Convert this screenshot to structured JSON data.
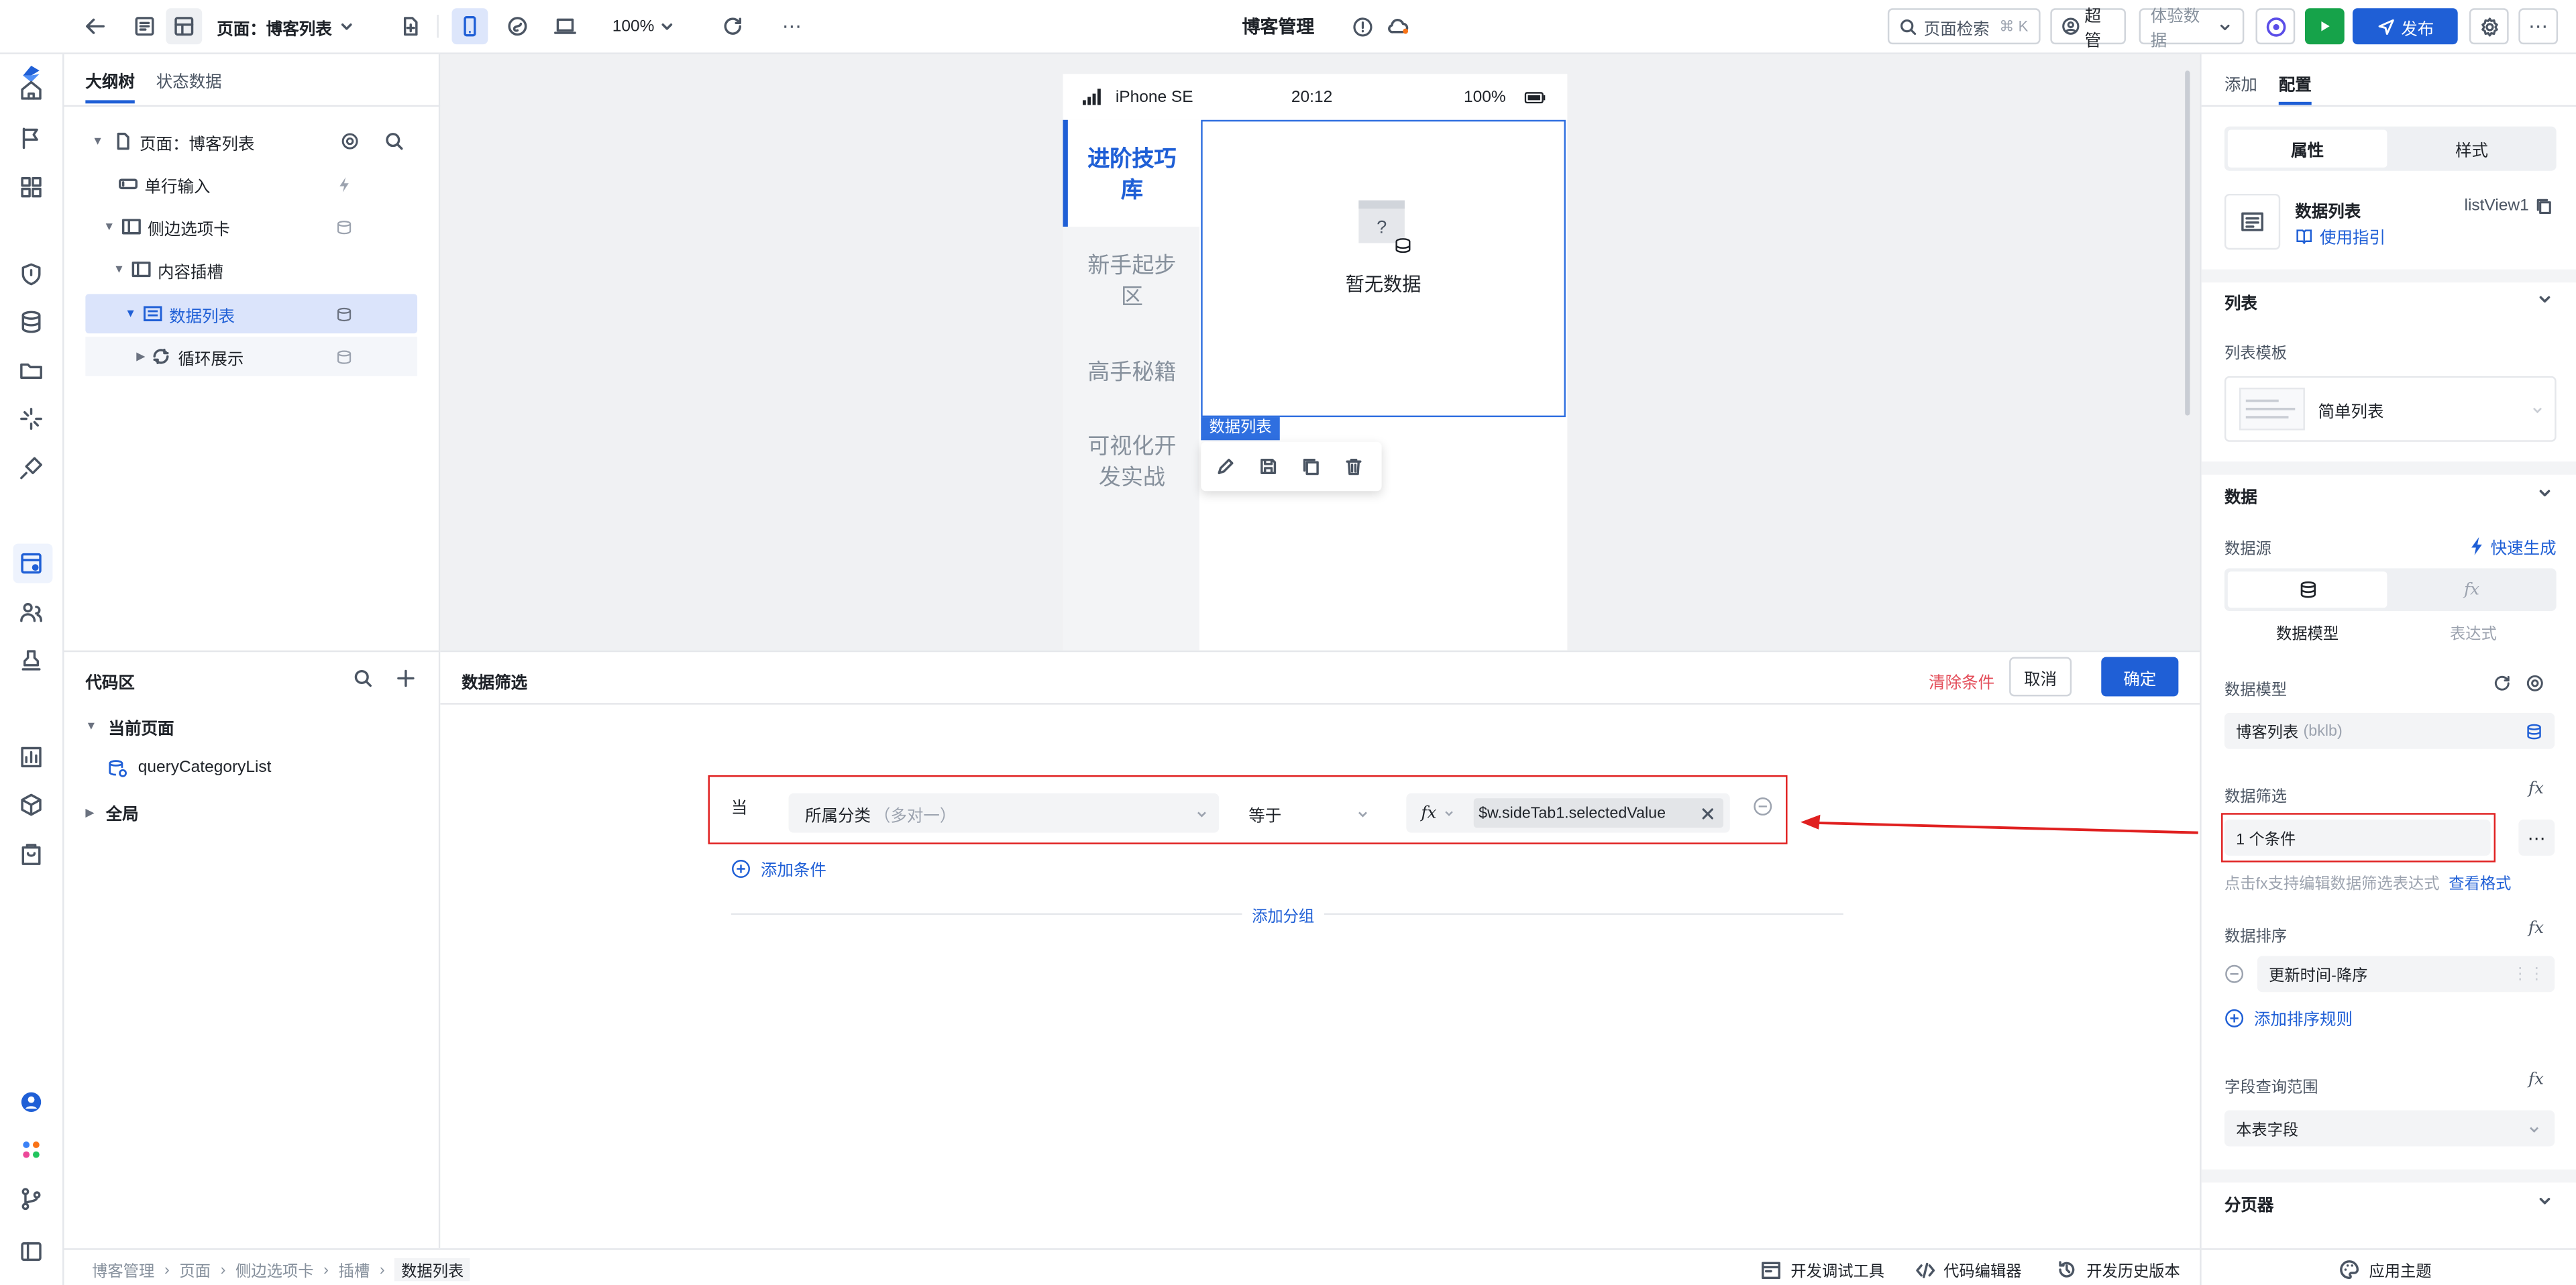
{
  "topbar": {
    "page_selector": "页面：博客列表",
    "zoom": "100%",
    "app_title": "博客管理",
    "search_label": "页面检索",
    "search_shortcut": "⌘ K",
    "user_label": "超管",
    "data_env": "体验数据",
    "publish_label": "发布"
  },
  "outline": {
    "tabs": [
      "大纲树",
      "状态数据"
    ],
    "tree": [
      {
        "label": "页面：博客列表"
      },
      {
        "label": "单行输入"
      },
      {
        "label": "侧边选项卡"
      },
      {
        "label": "内容插槽"
      },
      {
        "label": "数据列表"
      },
      {
        "label": "循环展示"
      }
    ]
  },
  "codearea": {
    "title": "代码区",
    "current_page": "当前页面",
    "query_item": "queryCategoryList",
    "global": "全局"
  },
  "phone": {
    "device": "iPhone SE",
    "time": "20:12",
    "battery": "100%",
    "side_tabs": [
      "进阶技巧库",
      "新手起步区",
      "高手秘籍",
      "可视化开发实战"
    ],
    "empty_text": "暂无数据",
    "selection_label": "数据列表"
  },
  "filter_panel": {
    "title": "数据筛选",
    "clear_label": "清除条件",
    "cancel_label": "取消",
    "confirm_label": "确定",
    "when_label": "当",
    "field_label": "所属分类",
    "field_hint": "（多对一）",
    "operator": "等于",
    "fx_label": "fx",
    "value_expr": "$w.sideTab1.selectedValue",
    "add_condition": "添加条件",
    "add_group": "添加分组"
  },
  "right_panel": {
    "tabs": [
      "添加",
      "配置"
    ],
    "seg_tabs": [
      "属性",
      "样式"
    ],
    "component_name": "数据列表",
    "component_id": "listView1",
    "guide_link": "使用指引",
    "list_section": "列表",
    "list_template_label": "列表模板",
    "list_template_value": "简单列表",
    "data_section": "数据",
    "datasource_label": "数据源",
    "quick_generate": "快速生成",
    "source_options": [
      "数据模型",
      "表达式"
    ],
    "data_model_label": "数据模型",
    "data_model_value": "博客列表",
    "data_model_code": "(bklb)",
    "filter_label": "数据筛选",
    "filter_value": "1 个条件",
    "filter_hint": "点击fx支持编辑数据筛选表达式",
    "filter_hint_link": "查看格式",
    "sort_label": "数据排序",
    "sort_value": "更新时间-降序",
    "add_sort": "添加排序规则",
    "field_scope_label": "字段查询范围",
    "field_scope_value": "本表字段",
    "pager_section": "分页器"
  },
  "bottombar": {
    "breadcrumb": [
      "博客管理",
      "页面",
      "侧边选项卡",
      "插槽",
      "数据列表"
    ],
    "tools": [
      "开发调试工具",
      "代码编辑器",
      "开发历史版本"
    ],
    "theme": "应用主题"
  },
  "colors": {
    "primary": "#1f5fd6",
    "highlight_red": "#e02020",
    "selection_bg": "#dbe4fb",
    "green": "#16a34a"
  }
}
